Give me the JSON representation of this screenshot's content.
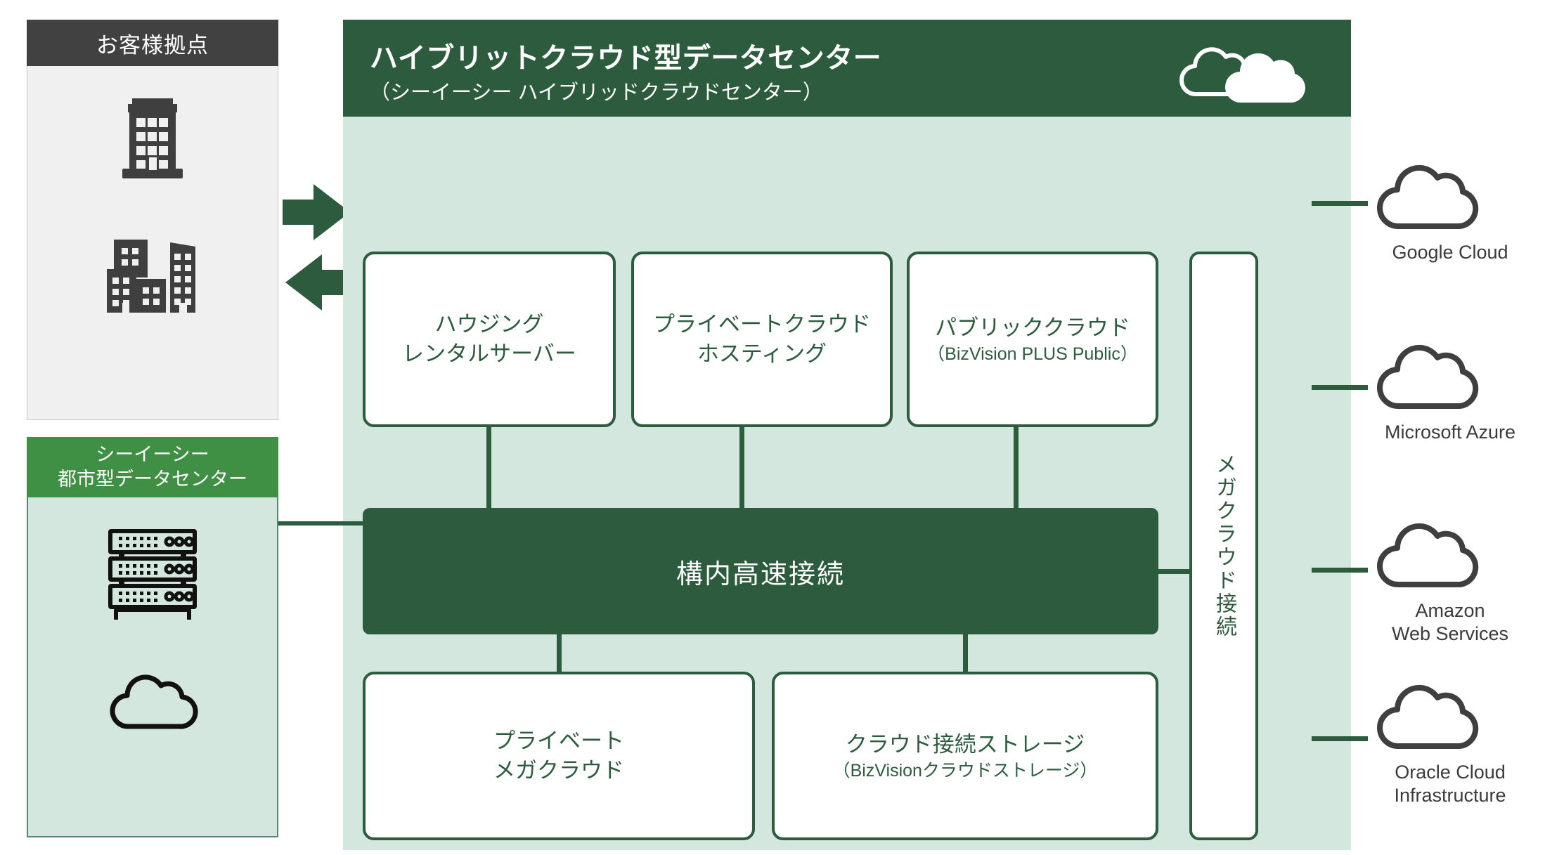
{
  "customer": {
    "header_label": "お客様拠点",
    "icons": [
      "office-building-icon",
      "city-buildings-icon"
    ]
  },
  "city_dc": {
    "header_line1": "シーイーシー",
    "header_line2": "都市型データセンター",
    "icons": [
      "server-rack-icon",
      "cloud-outline-icon"
    ]
  },
  "arrows": {
    "right_arrow": "arrow-right-icon",
    "left_arrow": "arrow-left-icon"
  },
  "datacenter": {
    "title": "ハイブリットクラウド型データセンター",
    "subtitle": "（シーイーシー ハイブリッドクラウドセンター）",
    "header_icon": "double-cloud-icon",
    "core_label": "構内高速接続",
    "mega_label": "メガクラウド接続",
    "top_boxes": [
      {
        "line1": "ハウジング",
        "line2": "レンタルサーバー",
        "sub": ""
      },
      {
        "line1": "プライベートクラウド",
        "line2": "ホスティング",
        "sub": ""
      },
      {
        "line1": "パブリッククラウド",
        "line2": "",
        "sub": "（BizVision PLUS Public）"
      }
    ],
    "bottom_boxes": [
      {
        "line1": "プライベート",
        "line2": "メガクラウド",
        "sub": ""
      },
      {
        "line1": "クラウド接続ストレージ",
        "line2": "",
        "sub": "（BizVisionクラウドストレージ）"
      }
    ]
  },
  "clouds": [
    {
      "label": "Google Cloud",
      "icon": "cloud-outline-icon"
    },
    {
      "label": "Microsoft Azure",
      "icon": "cloud-outline-icon"
    },
    {
      "label": "Amazon\nWeb Services",
      "icon": "cloud-outline-icon"
    },
    {
      "label": "Oracle Cloud\nInfrastructure",
      "icon": "cloud-outline-icon"
    }
  ],
  "colors": {
    "dark_green": "#2c5c3d",
    "mid_green": "#3f9045",
    "mint": "#d4e7df",
    "dark_gray": "#414141",
    "light_gray": "#f0f0f0",
    "icon_gray": "#3f3f3f"
  }
}
